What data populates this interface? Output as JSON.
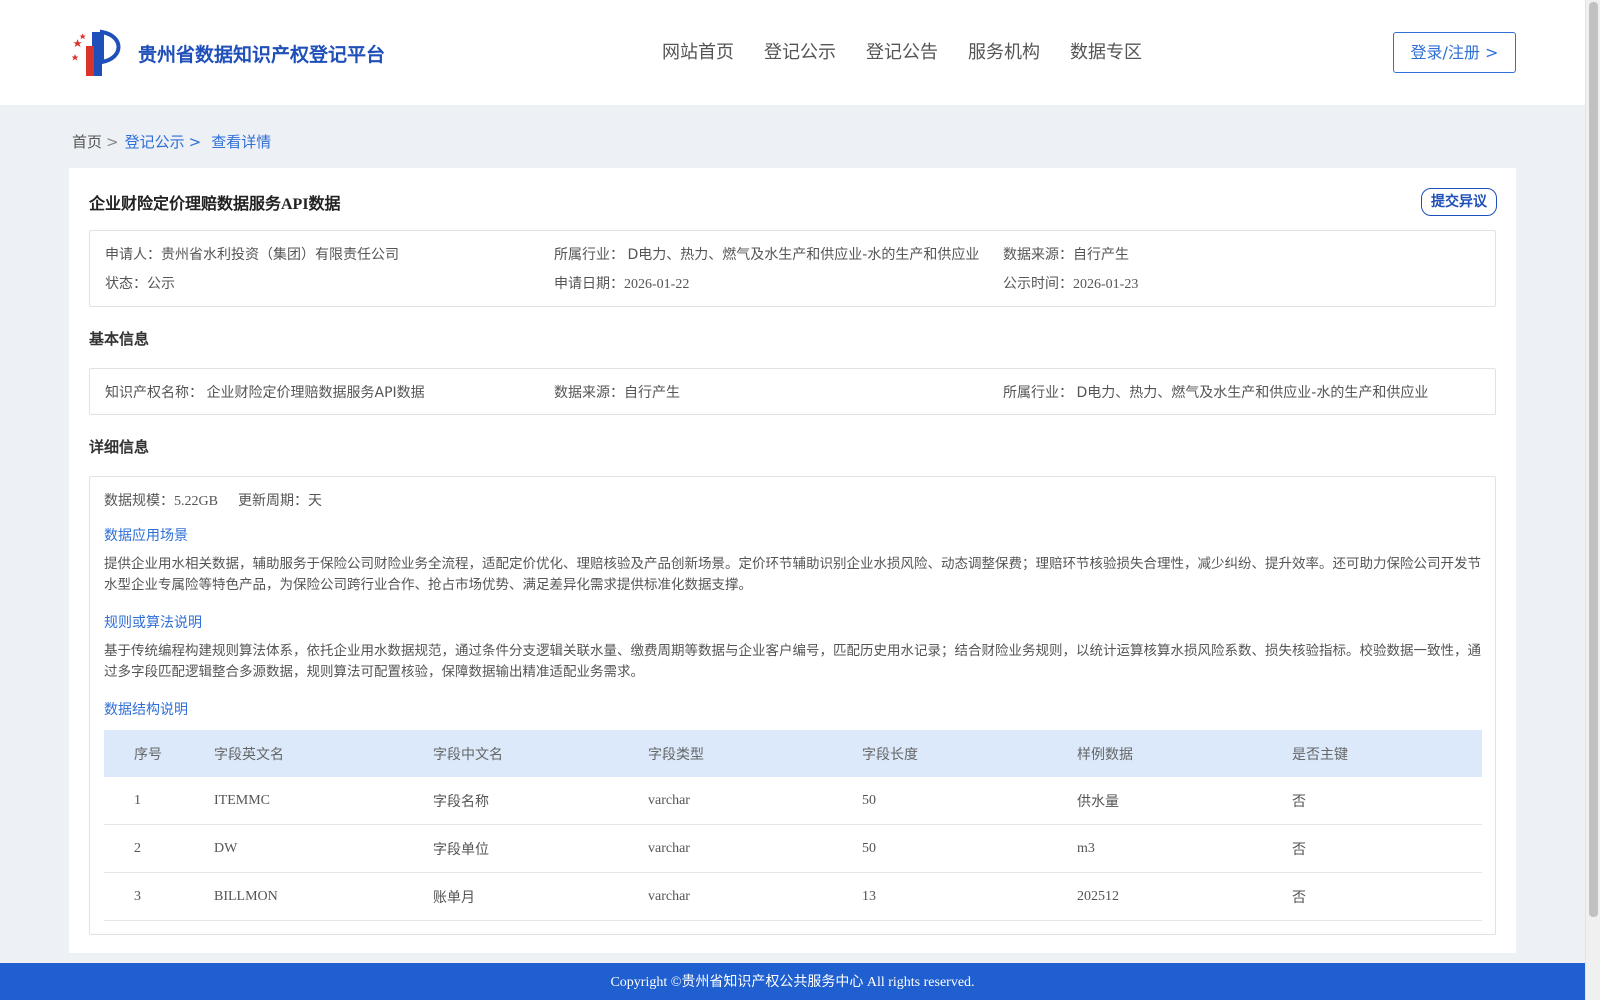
{
  "header": {
    "site_title": "贵州省数据知识产权登记平台",
    "nav": [
      "网站首页",
      "登记公示",
      "登记公告",
      "服务机构",
      "数据专区"
    ],
    "login_label": "登录/注册 >"
  },
  "breadcrumb": {
    "home": "首页",
    "list": "登记公示",
    "current": "查看详情",
    "sep": ">"
  },
  "detail": {
    "title": "企业财险定价理赔数据服务API数据",
    "objection_label": "提交异议",
    "summary": {
      "applicant_k": "申请人：",
      "applicant_v": "贵州省水利投资（集团）有限责任公司",
      "industry_k": "所属行业：",
      "industry_v": "D电力、热力、燃气及水生产和供应业-水的生产和供应业",
      "source_k": "数据来源：",
      "source_v": "自行产生",
      "status_k": "状态：",
      "status_v": "公示",
      "apply_date_k": "申请日期：",
      "apply_date_v": "2026-01-22",
      "publicity_k": "公示时间：",
      "publicity_v": "2026-01-23"
    },
    "basic_title": "基本信息",
    "basic": {
      "ip_name_k": "知识产权名称：",
      "ip_name_v": "企业财险定价理赔数据服务API数据",
      "source_k": "数据来源：",
      "source_v": "自行产生",
      "industry_k": "所属行业：",
      "industry_v": "D电力、热力、燃气及水生产和供应业-水的生产和供应业"
    },
    "detail_title": "详细信息",
    "scale_k": "数据规模：",
    "scale_v": "5.22GB",
    "cycle_k": "更新周期：",
    "cycle_v": "天",
    "scene_title": "数据应用场景",
    "scene_text": "提供企业用水相关数据，辅助服务于保险公司财险业务全流程，适配定价优化、理赔核验及产品创新场景。定价环节辅助识别企业水损风险、动态调整保费；理赔环节核验损失合理性，减少纠纷、提升效率。还可助力保险公司开发节水型企业专属险等特色产品，为保险公司跨行业合作、抢占市场优势、满足差异化需求提供标准化数据支撑。",
    "rule_title": "规则或算法说明",
    "rule_text": "基于传统编程构建规则算法体系，依托企业用水数据规范，通过条件分支逻辑关联水量、缴费周期等数据与企业客户编号，匹配历史用水记录；结合财险业务规则，以统计运算核算水损风险系数、损失核验指标。校验数据一致性，通过多字段匹配逻辑整合多源数据，规则算法可配置核验，保障数据输出精准适配业务需求。",
    "struct_title": "数据结构说明",
    "table": {
      "headers": [
        "序号",
        "字段英文名",
        "字段中文名",
        "字段类型",
        "字段长度",
        "样例数据",
        "是否主键"
      ],
      "rows": [
        [
          "1",
          "ITEMMC",
          "字段名称",
          "varchar",
          "50",
          "供水量",
          "否"
        ],
        [
          "2",
          "DW",
          "字段单位",
          "varchar",
          "50",
          "m3",
          "否"
        ],
        [
          "3",
          "BILLMON",
          "账单月",
          "varchar",
          "13",
          "202512",
          "否"
        ]
      ]
    }
  },
  "footer": {
    "copyright": "Copyright ©贵州省知识产权公共服务中心 All rights reserved."
  },
  "colors": {
    "brand_blue": "#1f5fcf",
    "link_blue": "#2f6fd6",
    "table_header_bg": "#dbe9fb"
  }
}
